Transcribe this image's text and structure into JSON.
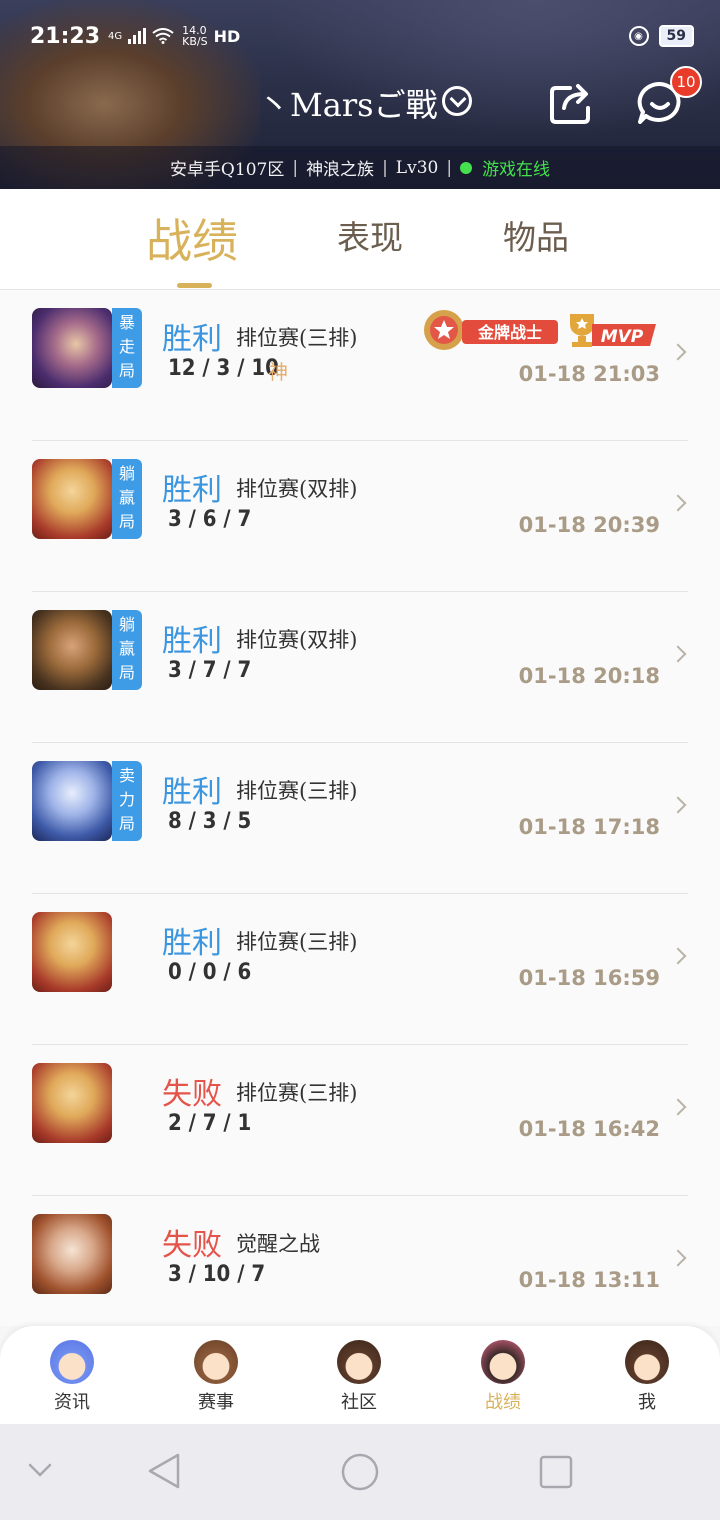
{
  "status": {
    "time": "21:23",
    "network": "4G",
    "speed_value": "14.0",
    "speed_unit": "KB/S",
    "hd": "HD",
    "battery": "59"
  },
  "header": {
    "player_name": "丶Marsご戰",
    "notification_count": "10",
    "server": "安卓手Q107区",
    "clan": "神浪之族",
    "level": "Lv30",
    "online_status": "游戏在线"
  },
  "tabs": [
    {
      "label": "战绩",
      "active": true
    },
    {
      "label": "表现",
      "active": false
    },
    {
      "label": "物品",
      "active": false
    }
  ],
  "matches": [
    {
      "tag": "暴走局",
      "result": "胜利",
      "result_type": "win",
      "mode": "排位赛(三排)",
      "kda": "12 / 3 / 10",
      "god": "神",
      "badge_gold": "金牌战士",
      "badge_mvp": "MVP",
      "time": "01-18 21:03"
    },
    {
      "tag": "躺赢局",
      "result": "胜利",
      "result_type": "win",
      "mode": "排位赛(双排)",
      "kda": "3 / 6 / 7",
      "time": "01-18 20:39"
    },
    {
      "tag": "躺赢局",
      "result": "胜利",
      "result_type": "win",
      "mode": "排位赛(双排)",
      "kda": "3 / 7 / 7",
      "time": "01-18 20:18"
    },
    {
      "tag": "卖力局",
      "result": "胜利",
      "result_type": "win",
      "mode": "排位赛(三排)",
      "kda": "8 / 3 / 5",
      "time": "01-18 17:18"
    },
    {
      "tag": "",
      "result": "胜利",
      "result_type": "win",
      "mode": "排位赛(三排)",
      "kda": "0 / 0 / 6",
      "time": "01-18 16:59"
    },
    {
      "tag": "",
      "result": "失败",
      "result_type": "lose",
      "mode": "排位赛(三排)",
      "kda": "2 / 7 / 1",
      "time": "01-18 16:42"
    },
    {
      "tag": "",
      "result": "失败",
      "result_type": "lose",
      "mode": "觉醒之战",
      "kda": "3 / 10 / 7",
      "time": "01-18 13:11"
    }
  ],
  "bottom_nav": [
    {
      "label": "资讯",
      "active": false
    },
    {
      "label": "赛事",
      "active": false
    },
    {
      "label": "社区",
      "active": false
    },
    {
      "label": "战绩",
      "active": true
    },
    {
      "label": "我",
      "active": false
    }
  ],
  "colors": {
    "accent_gold": "#d8b25a",
    "win_blue": "#3c96df",
    "lose_red": "#e5544a",
    "online_green": "#45e04e",
    "badge_red": "#e83b2a"
  }
}
